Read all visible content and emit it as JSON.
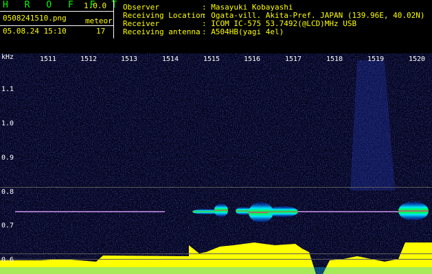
{
  "header": {
    "logo": "H R O F F T",
    "version": "1.0.0",
    "filename": "0508241510.png",
    "datetime": "05.08.24 15:10",
    "meteor_label": "meteor",
    "meteor_count": "17",
    "fields": [
      {
        "label": "Observer",
        "value": ": Masayuki Kobayashi"
      },
      {
        "label": "Receiving Location",
        "value": ": Ogata-vill. Akita-Pref. JAPAN (139.96E, 40.02N)"
      },
      {
        "label": "Receiver",
        "value": ": ICOM IC-575 53.7492(@LCD)MHz USB"
      },
      {
        "label": "Receiving antenna",
        "value": ": A504HB(yagi 4el)"
      }
    ]
  },
  "spectrogram": {
    "y_unit": "kHz",
    "y_ticks": [
      "1.1",
      "1.0",
      "0.9",
      "0.8",
      "0.7",
      "0.6"
    ],
    "time_ticks": [
      "1511",
      "1512",
      "1513",
      "1514",
      "1515",
      "1516",
      "1517",
      "1518",
      "1519",
      "1520"
    ]
  }
}
